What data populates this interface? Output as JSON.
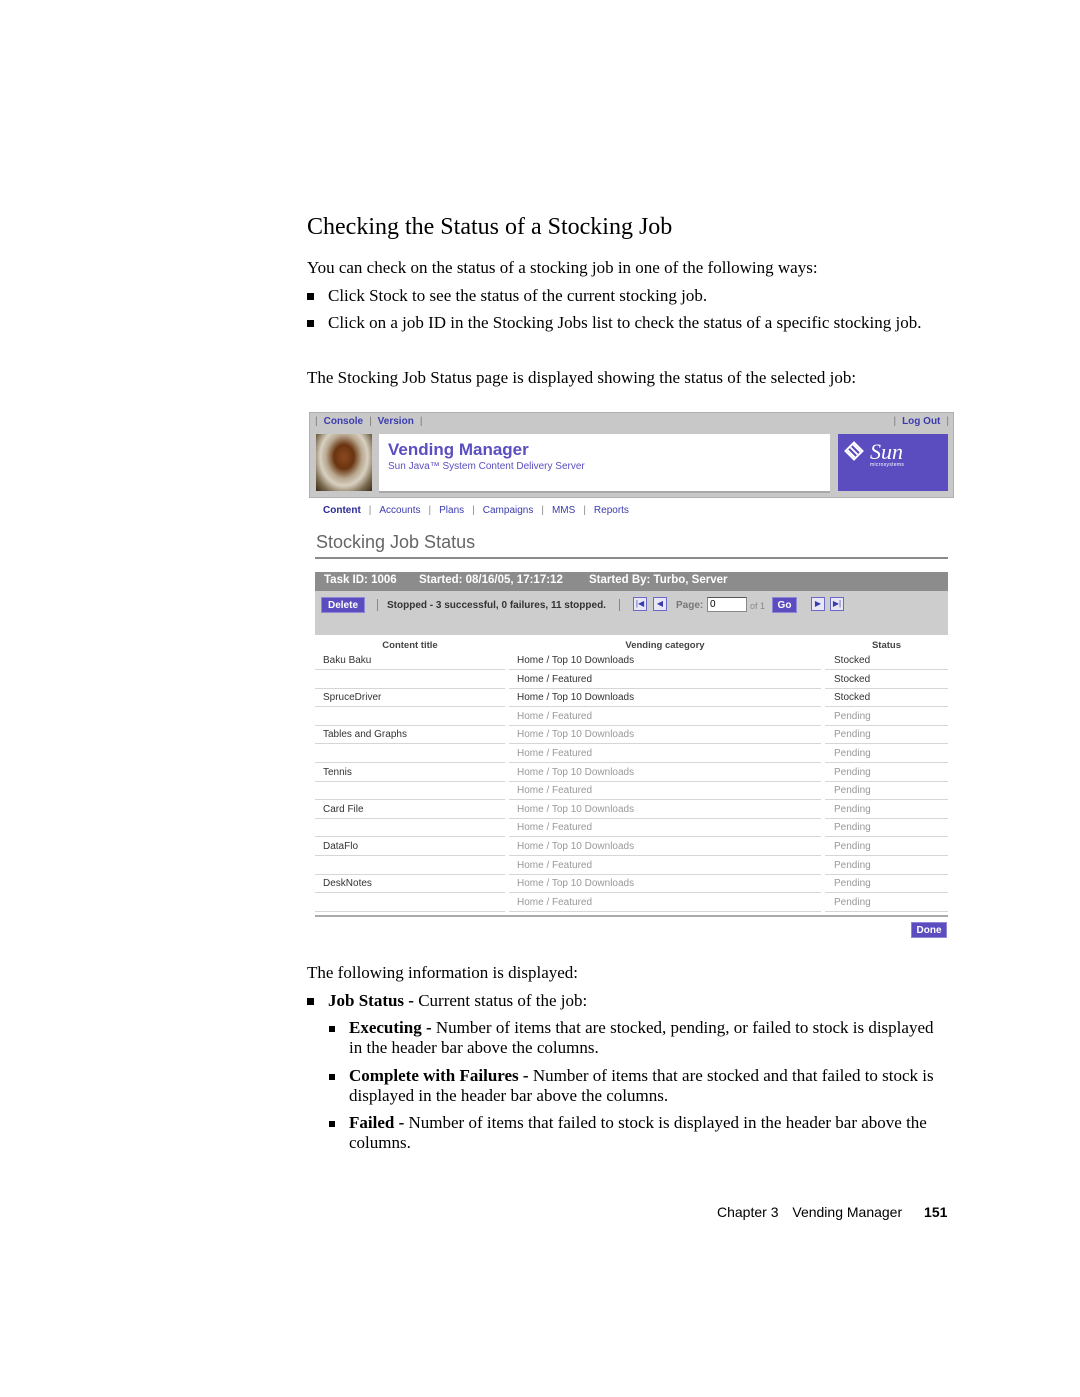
{
  "document": {
    "title": "Checking the Status of a Stocking Job",
    "intro": "You can check on the status of a stocking job in one of the following ways:",
    "bullets": [
      "Click Stock to see the status of the current stocking job.",
      "Click on a job ID in the Stocking Jobs list to check the status of a specific stocking job."
    ],
    "lead_in": "The Stocking Job Status page is displayed showing the status of the selected job:",
    "following": "The following information is displayed:",
    "info_items": [
      {
        "term": "Job Status -",
        "desc": " Current status of the job:"
      }
    ],
    "sub_items": [
      {
        "term": "Executing -",
        "desc": " Number of items that are stocked, pending, or failed to stock is displayed in the header bar above the columns."
      },
      {
        "term": "Complete with Failures -",
        "desc": " Number of items that are stocked and that failed to stock is displayed in the header bar above the columns."
      },
      {
        "term": "Failed -",
        "desc": " Number of items that failed to stock is displayed in the header bar above the columns."
      }
    ],
    "footer": {
      "chapter": "Chapter 3",
      "section": "Vending Manager",
      "page": "151"
    }
  },
  "app": {
    "top_links": {
      "console": "Console",
      "version": "Version",
      "logout": "Log Out"
    },
    "name": "Vending Manager",
    "subtitle": "Sun Java™ System Content Delivery Server",
    "logo": {
      "word": "Sun",
      "micro": "microsystems"
    },
    "nav": [
      {
        "label": "Content",
        "active": true
      },
      {
        "label": "Accounts"
      },
      {
        "label": "Plans"
      },
      {
        "label": "Campaigns"
      },
      {
        "label": "MMS"
      },
      {
        "label": "Reports"
      }
    ],
    "page_heading": "Stocking Job Status",
    "task": {
      "id": "Task ID: 1006",
      "started": "Started: 08/16/05, 17:17:12",
      "started_by": "Started By: Turbo, Server"
    },
    "actions": {
      "delete": "Delete",
      "status": "Stopped - 3 successful, 0 failures, 11 stopped.",
      "page_label": "Page:",
      "page_value": "0",
      "page_of": "of 1",
      "go": "Go",
      "first_icon": "first-page-icon",
      "prev_icon": "prev-page-icon",
      "next_icon": "next-page-icon",
      "last_icon": "last-page-icon"
    },
    "columns": [
      "Content title",
      "Vending category",
      "Status"
    ],
    "rows": [
      {
        "title": "Baku Baku",
        "category": "Home / Top 10 Downloads",
        "status": "Stocked"
      },
      {
        "title": "",
        "category": "Home / Featured",
        "status": "Stocked"
      },
      {
        "title": "SpruceDriver",
        "category": "Home / Top 10 Downloads",
        "status": "Stocked"
      },
      {
        "title": "",
        "category": "Home / Featured",
        "status": "Pending"
      },
      {
        "title": "Tables and Graphs",
        "category": "Home / Top 10 Downloads",
        "status": "Pending"
      },
      {
        "title": "",
        "category": "Home / Featured",
        "status": "Pending"
      },
      {
        "title": "Tennis",
        "category": "Home / Top 10 Downloads",
        "status": "Pending"
      },
      {
        "title": "",
        "category": "Home / Featured",
        "status": "Pending"
      },
      {
        "title": "Card File",
        "category": "Home / Top 10 Downloads",
        "status": "Pending"
      },
      {
        "title": "",
        "category": "Home / Featured",
        "status": "Pending"
      },
      {
        "title": "DataFlo",
        "category": "Home / Top 10 Downloads",
        "status": "Pending"
      },
      {
        "title": "",
        "category": "Home / Featured",
        "status": "Pending"
      },
      {
        "title": "DeskNotes",
        "category": "Home / Top 10 Downloads",
        "status": "Pending"
      },
      {
        "title": "",
        "category": "Home / Featured",
        "status": "Pending"
      }
    ],
    "done": "Done",
    "colors": {
      "accent": "#5b4dc0",
      "link": "#3b3bb0",
      "bar": "#8c8c8c",
      "panel": "#cdcdcd"
    }
  }
}
